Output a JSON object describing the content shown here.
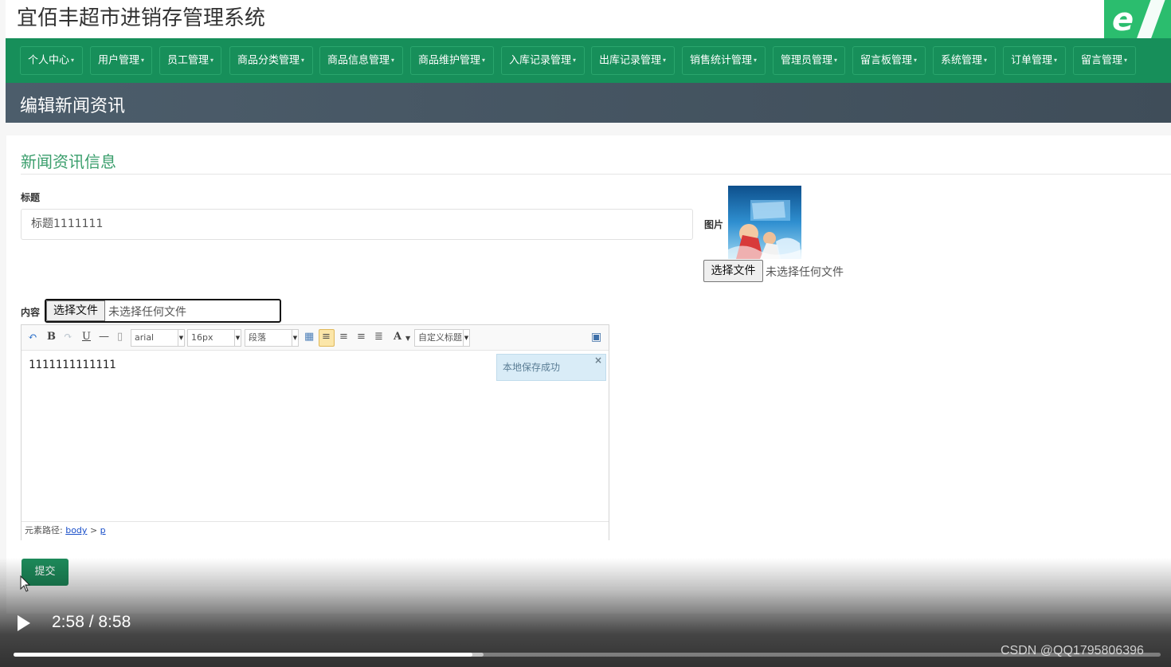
{
  "app": {
    "title": "宜佰丰超市进销存管理系统",
    "logo_letter": "e"
  },
  "nav": {
    "items": [
      {
        "label": "个人中心"
      },
      {
        "label": "用户管理"
      },
      {
        "label": "员工管理"
      },
      {
        "label": "商品分类管理"
      },
      {
        "label": "商品信息管理"
      },
      {
        "label": "商品维护管理"
      },
      {
        "label": "入库记录管理"
      },
      {
        "label": "出库记录管理"
      },
      {
        "label": "销售统计管理"
      },
      {
        "label": "管理员管理"
      },
      {
        "label": "留言板管理"
      },
      {
        "label": "系统管理"
      },
      {
        "label": "订单管理"
      },
      {
        "label": "留言管理"
      }
    ]
  },
  "page": {
    "heading": "编辑新闻资讯"
  },
  "form": {
    "section_title": "新闻资讯信息",
    "title_label": "标题",
    "title_value": "标题1111111",
    "image_label": "图片",
    "image_file_button": "选择文件",
    "image_file_status": "未选择任何文件",
    "content_label": "内容",
    "content_file_button": "选择文件",
    "content_file_status": "未选择任何文件",
    "submit_label": "提交"
  },
  "editor": {
    "font_family": "arial",
    "font_size": "16px",
    "paragraph": "段落",
    "custom_title": "自定义标题",
    "body_text": "1111111111111",
    "toast_text": "本地保存成功",
    "toast_close": "×",
    "path_label": "元素路径:",
    "path_body": "body",
    "path_sep": ">",
    "path_p": "p",
    "bold": "B",
    "underline": "U",
    "font_color": "A"
  },
  "video": {
    "time": "2:58 / 8:58",
    "played_fraction": 0.4,
    "buffered_fraction": 0.41,
    "watermark": "CSDN @QQ1795806396"
  }
}
